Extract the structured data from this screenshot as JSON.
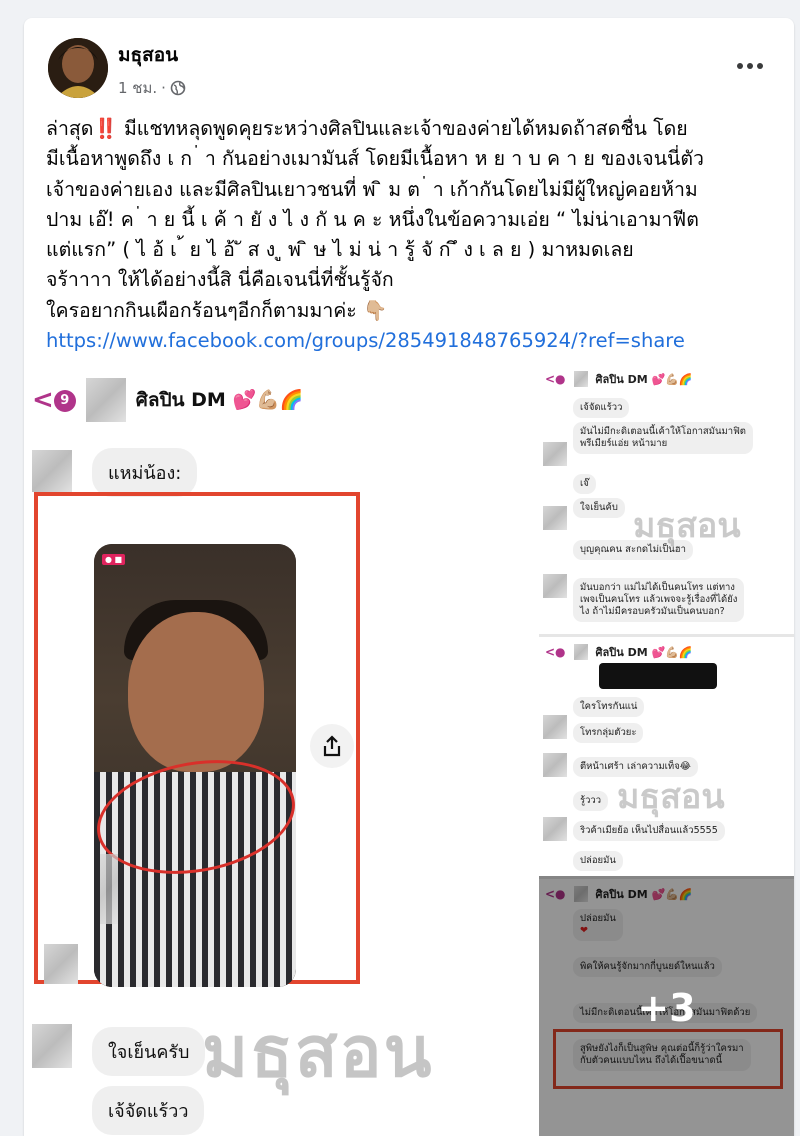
{
  "post": {
    "author": "มธุสอน",
    "time": "1 ชม.",
    "separator": "·",
    "privacy_icon": "globe-icon",
    "more_icon": "more-options-icon",
    "lines": [
      "ล่าสุด",
      "มีแชทหลุดพูดคุยระหว่างศิลปินและเจ้าของค่ายได้หมดถ้าสดชื่น โดย",
      "มีเนื้อหาพูดถึง เ ก ่ า กันอย่างเมามันส์ โดยมีเนื้อหา ห ย า บ ค า ย ของเจนนี่ตัว",
      "เจ้าของค่ายเอง และมีศิลปินเยาวชนที่ พ ิ ม ต ่ า เก้ากันโดยไม่มีผู้ใหญ่คอยห้าม",
      "ปาม เอ๊! ค ่ า ย นี้ เ ค้ า ยั ง ไ ง กั น ค ะ หนึ่งในข้อความเอ่ย “ ไม่น่าเอามาฟีต",
      "แต่แรก” ( ไ อ้ เ  ้ ย ไ อ้  ั ส ง ู พ ิ ษ   ไ ม่ น่ า รู้ จั ก   ึ ง เ ล ย ) มาหมดเลย",
      "จร้าาาา ให้ได้อย่างนี้สิ นี่คือเจนนี่ที่ชั้นรู้จัก",
      "ใครอยากกินเผือกร้อนๆอีกก็ตามมาค่ะ 👇🏼"
    ],
    "link": "https://www.facebook.com/groups/285491848765924/?ref=share"
  },
  "left_chat": {
    "back_count": "9",
    "title": "ศิลปิน DM 💕💪🏼🌈",
    "msg1": "แหม่น้อง:",
    "msg2": "ใจเย็นครับ",
    "msg3": "เจ้จัดแร้วว",
    "watermark": "มธุสอน"
  },
  "right_top": {
    "title": "ศิลปิน DM 💕💪🏼🌈",
    "msgs": [
      "เจ้จัดแร้วว",
      "มันไม่มีกะดิเตอนนี้เค้าให้โอกาสมันมาฟิต",
      "พรีเมียร์แอ่ย หน้ามาย",
      "เจ๊",
      "ใจเย็นค้บ",
      "บุญคุณคน สะกดไม่เป็นฮา",
      "มันบอกว่า แม่ไม่ได้เป็นคนโทร แต่ทาง",
      "เพจเป็นคนโทร แล้วเพจจะรู้เรื่องที่ได้ยัง",
      "ไง ถ้าไม่มีครอบครัวมันเป็นคนบอก?"
    ],
    "watermark": "มธุสอน"
  },
  "right_mid": {
    "title": "ศิลปิน DM 💕💪🏼🌈",
    "msgs": [
      "ใครโทรกันแน่",
      "โทรกลุ่มตัวยะ",
      "ตีหน้าเศร้า เล่าความเท็จ😂",
      "รู้ววว",
      "ริวค้าเมียย้อ เห็นไปสื่อนแล้ว5555",
      "ปล่อยมัน"
    ],
    "watermark": "มธุสอน"
  },
  "right_bot": {
    "title": "ศิลปิน DM 💕💪🏼🌈",
    "msgs": [
      "ปล่อยมัน",
      "❤",
      "พิคให้คนรู้จักมากกี่บูนยด์ใหนแล้ว",
      "ไม่มีกะดิเตอนนี้เค้าให้โอกาสมันมาฟิตด้วย",
      "สูพิษยังไงก็เป็นสูพิษ คุณต่อนี้ก็รู้ว่าใครมา",
      "กับตัวคนแบบไหน ถึงได้เปื๊อขนาดนี้"
    ],
    "more_count": "+3"
  },
  "colors": {
    "link": "#216fdb",
    "highlight_red": "#e2452e",
    "bubble": "#efefef",
    "secondary_text": "#65676b"
  }
}
